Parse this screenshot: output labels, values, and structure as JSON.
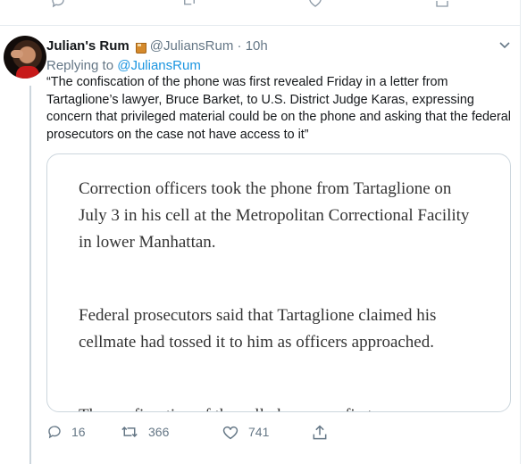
{
  "tweet": {
    "display_name": "Julian's Rum",
    "handle": "@JuliansRum",
    "separator": "·",
    "time": "10h",
    "replying_prefix": "Replying to",
    "replying_to": "@JuliansRum",
    "text": "“The confiscation of the phone was first revealed Friday in a letter from Tartaglione’s lawyer, Bruce Barket, to U.S. District Judge Karas, expressing concern that privileged material could be on the phone and asking that the federal prosecutors on the case not have access to it”",
    "card_paragraphs": [
      "Correction officers took the phone from Tartaglione on July 3 in his cell at the Metropolitan Correctional Facility in lower Manhattan.",
      "Federal prosecutors said that Tartaglione claimed his cellmate had tossed it to him as officers approached.",
      "The confiscation of the cell phone was first"
    ],
    "stats": {
      "replies": "16",
      "retweets": "366",
      "likes": "741"
    }
  },
  "icons": [
    "reply-icon",
    "retweet-icon",
    "like-icon",
    "share-icon",
    "chevron-down-icon",
    "tumbler-glass-emoji"
  ]
}
